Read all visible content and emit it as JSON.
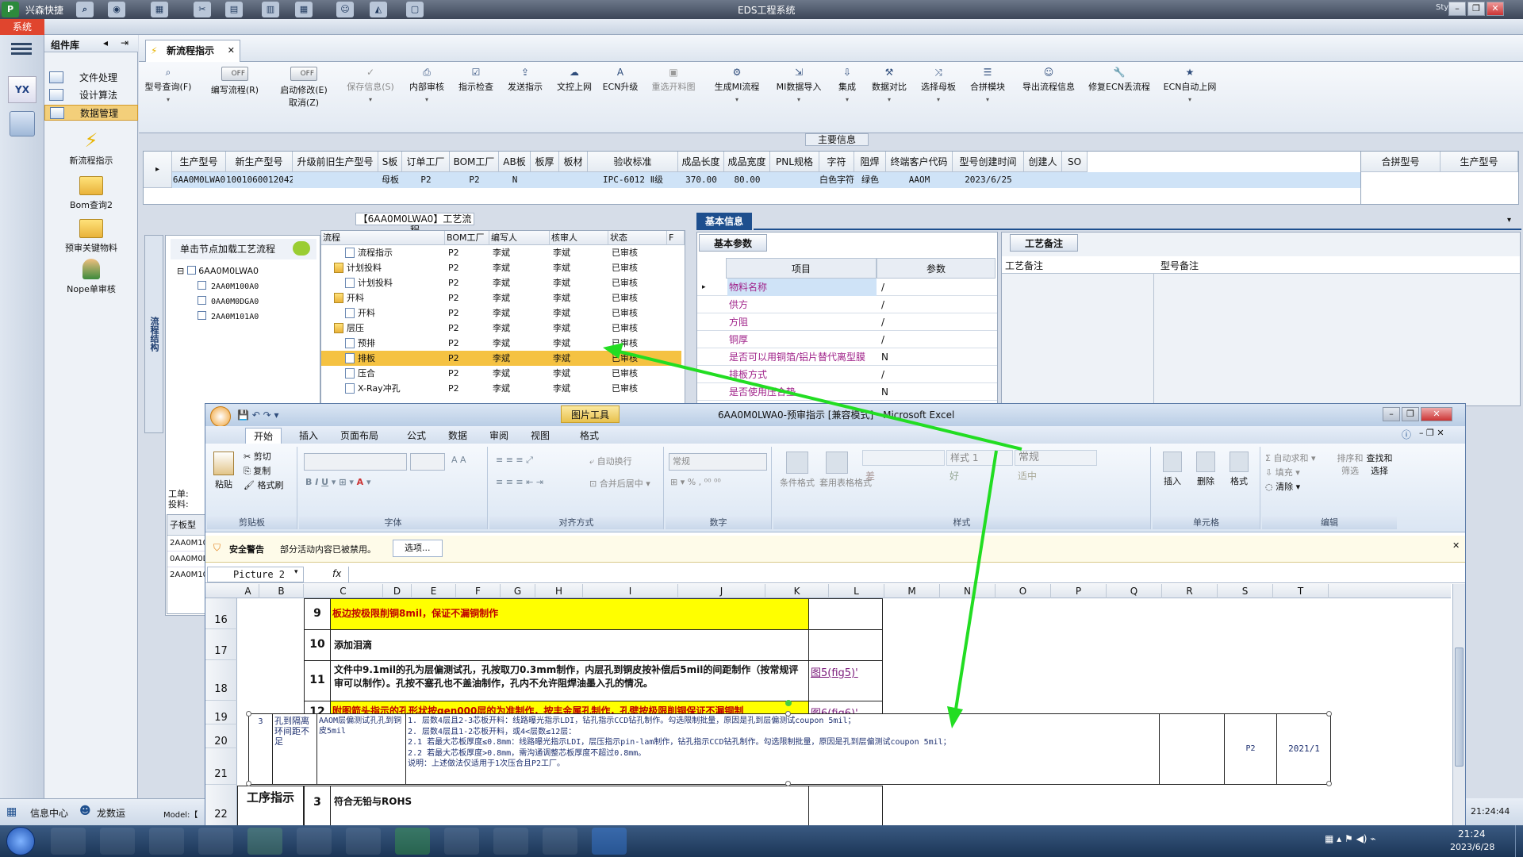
{
  "titlebar": {
    "app_left": "兴森快捷",
    "title": "EDS工程系统",
    "style_label": "Style ·"
  },
  "menu": {
    "system": "系统"
  },
  "left_nav": {
    "logo_text": "YX"
  },
  "component_lib": {
    "title": "组件库",
    "items": [
      "文件处理",
      "设计算法",
      "数据管理"
    ],
    "tools": [
      "新流程指示",
      "Bom查询2",
      "预审关键物料",
      "Nope单审核"
    ]
  },
  "doc_tab": {
    "label": "新流程指示"
  },
  "ribbon": {
    "buttons": [
      "型号查询(F)",
      "编写流程(R)",
      "启动修改(E)",
      "保存信息(S)",
      "内部审核",
      "指示检查",
      "发送指示",
      "文控上网",
      "ECN升级",
      "重选开料图",
      "生成MI流程",
      "MI数据导入",
      "集成",
      "数据对比",
      "选择母板",
      "合拼模块",
      "导出流程信息",
      "修复ECN丢流程",
      "ECN自动上网"
    ],
    "toggle_off": "OFF",
    "cancel": "取消(Z)"
  },
  "main_info": {
    "section_title": "主要信息",
    "headers": [
      "生产型号",
      "新生产型号",
      "升级前旧生产型号",
      "S板",
      "订单工厂",
      "BOM工厂",
      "AB板",
      "板厚",
      "板材",
      "验收标准",
      "成品长度",
      "成品宽度",
      "PNL规格",
      "字符",
      "阻焊",
      "终端客户代码",
      "型号创建时间",
      "创建人",
      "SO"
    ],
    "row": [
      "6AA0M0LWA0",
      "10010600120424",
      "",
      "母板",
      "P2",
      "P2",
      "N",
      "",
      "",
      "IPC-6012 Ⅱ级",
      "370.00",
      "80.00",
      "",
      "白色字符",
      "绿色",
      "AAOM",
      "2023/6/25",
      "",
      ""
    ],
    "right_headers": [
      "合拼型号",
      "生产型号"
    ]
  },
  "flow": {
    "title": "【6AA0M0LWA0】工艺流程",
    "side_tab": "流程结构",
    "hint": "单击节点加载工艺流程",
    "tree": [
      "6AA0M0LWA0",
      "2AA0M100A0",
      "0AA0M0DGA0",
      "2AA0M101A0"
    ],
    "headers": [
      "流程",
      "BOM工厂",
      "编写人",
      "核审人",
      "状态"
    ],
    "rows": [
      {
        "name": "流程指示",
        "bom": "P2",
        "writer": "李斌",
        "checker": "李斌",
        "status": "已审核"
      },
      {
        "name": "计划投料",
        "bom": "P2",
        "writer": "李斌",
        "checker": "李斌",
        "status": "已审核"
      },
      {
        "name": "计划投料",
        "bom": "P2",
        "writer": "李斌",
        "checker": "李斌",
        "status": "已审核"
      },
      {
        "name": "开料",
        "bom": "P2",
        "writer": "李斌",
        "checker": "李斌",
        "status": "已审核"
      },
      {
        "name": "开料",
        "bom": "P2",
        "writer": "李斌",
        "checker": "李斌",
        "status": "已审核"
      },
      {
        "name": "层压",
        "bom": "P2",
        "writer": "李斌",
        "checker": "李斌",
        "status": "已审核"
      },
      {
        "name": "预排",
        "bom": "P2",
        "writer": "李斌",
        "checker": "李斌",
        "status": "已审核"
      },
      {
        "name": "排板",
        "bom": "P2",
        "writer": "李斌",
        "checker": "李斌",
        "status": "已审核"
      },
      {
        "name": "压合",
        "bom": "P2",
        "writer": "李斌",
        "checker": "李斌",
        "status": "已审核"
      },
      {
        "name": "X-Ray冲孔",
        "bom": "P2",
        "writer": "李斌",
        "checker": "李斌",
        "status": "已审核"
      }
    ],
    "job_labels": [
      "工单:",
      "投料:"
    ],
    "sub_header": "子板型",
    "sub_rows": [
      "2AA0M10",
      "0AA0M0D",
      "2AA0M10"
    ]
  },
  "basic_info": {
    "tab": "基本信息",
    "sub_tab": "基本参数",
    "col_item": "项目",
    "col_param": "参数",
    "rows": [
      {
        "item": "物料名称",
        "value": "/"
      },
      {
        "item": "供方",
        "value": "/"
      },
      {
        "item": "方阻",
        "value": "/"
      },
      {
        "item": "铜厚",
        "value": "/"
      },
      {
        "item": "是否可以用铜箔/铝片替代离型膜",
        "value": "N"
      },
      {
        "item": "排板方式",
        "value": "/"
      },
      {
        "item": "是否使用压合垫",
        "value": "N"
      }
    ]
  },
  "remarks": {
    "tab": "工艺备注",
    "col1": "工艺备注",
    "col2": "型号备注"
  },
  "excel": {
    "window_title": "6AA0M0LWA0-预审指示  [兼容模式] - Microsoft Excel",
    "picture_tools": "图片工具",
    "tabs": [
      "开始",
      "插入",
      "页面布局",
      "公式",
      "数据",
      "审阅",
      "视图",
      "格式"
    ],
    "groups": [
      "剪贴板",
      "字体",
      "对齐方式",
      "数字",
      "样式",
      "单元格",
      "编辑"
    ],
    "clip": [
      "粘贴",
      "剪切",
      "复制",
      "格式刷"
    ],
    "wrap": "自动换行",
    "merge": "合并后居中",
    "num_format": "常规",
    "styles": [
      "样式 1",
      "常规",
      "差",
      "好",
      "适中"
    ],
    "cond_format": "条件格式",
    "table_format": "套用表格格式",
    "cells_btns": [
      "插入",
      "删除",
      "格式"
    ],
    "edit_btns": [
      "自动求和",
      "填充",
      "清除",
      "排序和筛选",
      "查找和选择"
    ],
    "warning_label": "安全警告",
    "warning_text": "部分活动内容已被禁用。",
    "options_button": "选项...",
    "name_box": "Picture 2",
    "fx": "fx",
    "columns": [
      "A",
      "B",
      "C",
      "D",
      "E",
      "F",
      "G",
      "H",
      "I",
      "J",
      "K",
      "L",
      "M",
      "N",
      "O",
      "P",
      "Q",
      "R",
      "S",
      "T"
    ],
    "row_numbers": [
      "16",
      "17",
      "18",
      "19",
      "20",
      "21",
      "22"
    ],
    "cells": {
      "r16_num": "9",
      "r16_text": "板边按极限削铜8mil，保证不漏铜制作",
      "r17_num": "10",
      "r17_text": "添加泪滴",
      "r18_num": "11",
      "r18_text": "文件中9.1mil的孔为层偏测试孔，孔按取刀0.3mm制作，内层孔到铜皮按补偿后5mil的间距制作（按常规评审可以制作）。孔按不塞孔也不盖油制作，孔内不允许阻焊油墨入孔的情况。",
      "r18_link": "图5(fig5)'",
      "r19_num": "12",
      "r19_text": "附图箭头指示的孔形状按gen000层的为准制作，按丰金属孔制作，孔壁按极限削铜保证不漏铜制",
      "r19_link": "图6(fig6)'",
      "r22_label": "工序指示",
      "r22_num": "3",
      "r22_text": "符合无铅与ROHS"
    },
    "picture": {
      "num": "3",
      "c2": "孔到隔离环间距不足",
      "c3": "AAOM层偏测试孔孔到铜皮5mil",
      "lines": [
        "1. 层数4层且2-3芯板开料：线路曝光指示LDI，钻孔指示CCD钻孔制作。勾选限制批量，原因是孔到层偏测试coupon  5mil；",
        "2. 层数4层且1-2芯板开料，或4<层数≤12层：",
        "2.1 若最大芯板厚度≤0.8mm：线路曝光指示LDI，层压指示pin-lam制作，钻孔指示CCD钻孔制作。勾选限制批量，原因是孔到层偏测试coupon  5mil；",
        "2.2 若最大芯板厚度>0.8mm，需沟通调整芯板厚度不超过0.8mm。",
        "说明：上述做法仅适用于1次压合且P2工厂。"
      ],
      "factory": "P2",
      "date": "2021/1"
    }
  },
  "statusbar": {
    "info_center": "信息中心",
    "user": "龙数运",
    "model_label": "Model:【",
    "time_right": "21:24:44"
  },
  "taskbar": {
    "time": "21:24",
    "date": "2023/6/28"
  }
}
